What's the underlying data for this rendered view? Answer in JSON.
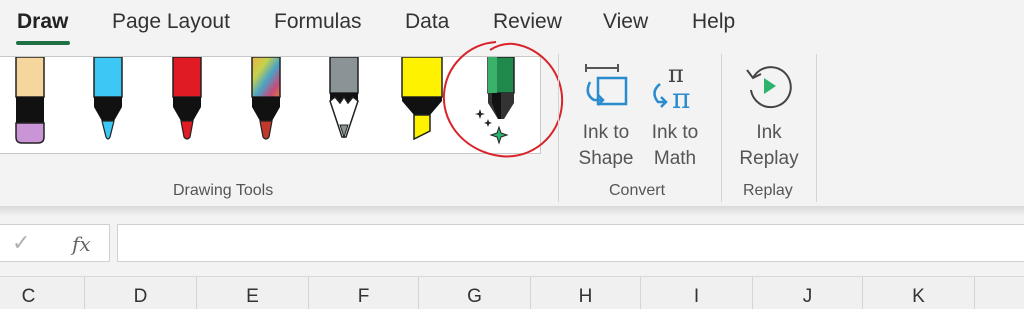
{
  "tabs": [
    "Draw",
    "Page Layout",
    "Formulas",
    "Data",
    "Review",
    "View",
    "Help"
  ],
  "active_tab": "Draw",
  "accent_color": "#1f7145",
  "drawing_tools": {
    "group_label": "Drawing Tools",
    "pens": [
      {
        "name": "pen-lavender",
        "color": "#c995d6"
      },
      {
        "name": "pen-light-blue",
        "color": "#3cc7f5"
      },
      {
        "name": "pen-red",
        "color": "#e01b24"
      },
      {
        "name": "pen-galaxy",
        "color": "#c0392b"
      },
      {
        "name": "pencil-gray",
        "color": "#8a9497"
      },
      {
        "name": "highlighter-yellow",
        "color": "#fff200"
      },
      {
        "name": "action-pen",
        "color": "#1f8a4c"
      }
    ],
    "annotation_color": "#d9232a"
  },
  "convert": {
    "group_label": "Convert",
    "ink_to_shape": [
      "Ink to",
      "Shape"
    ],
    "ink_to_math": [
      "Ink to",
      "Math"
    ],
    "math_symbol": "π"
  },
  "replay": {
    "group_label": "Replay",
    "ink_replay": [
      "Ink",
      "Replay"
    ]
  },
  "formula_bar": {
    "check": "✓",
    "fx": "fx",
    "value": ""
  },
  "columns": [
    "C",
    "D",
    "E",
    "F",
    "G",
    "H",
    "I",
    "J",
    "K"
  ]
}
